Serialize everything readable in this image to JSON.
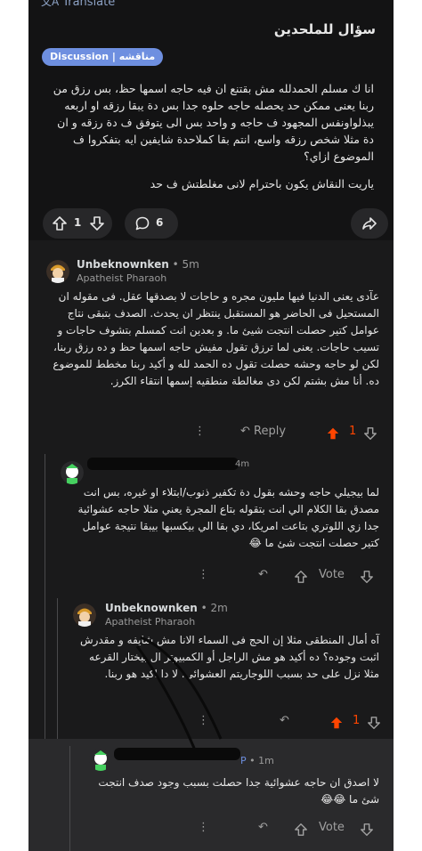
{
  "colors": {
    "background": "#1a1a1b",
    "header_bg": "#131314",
    "flair_bg": "#6e8fe0",
    "upvote_active": "#ff4500",
    "link": "#8da2c5"
  },
  "header": {
    "translate_label": "Translate",
    "translate_icon": "translate-icon"
  },
  "post": {
    "title": "سؤال للملحدين",
    "flair": "Discussion | مناقشه",
    "body_paragraphs": [
      "انا ك مسلم الحمدلله مش بقتنع ان فيه حاجه اسمها حظ، بس رزق من ربنا يعنى ممكن حد يحصله حاجه حلوه جدا بس دة يبقا رزقه او اربعه يبذلواونفس المجهود ف حاجه و واحد بس الى يتوفق ف دة رزقه و ان دة مثلا شخص رزقه واسع، انتم بقا كملاحدة شايفين ايه بتفكروا ف الموضوع ازاي؟",
      "ياريت النقاش يكون باحترام لانى مغلطتش ف حد"
    ],
    "votes": "1",
    "comments": "6",
    "share_icon": "share-icon"
  },
  "comments": [
    {
      "username": "Unbeknownken",
      "time": "5m",
      "user_flair": "Apatheist Pharaoh",
      "text": "عآدى يعنى الدنيا فيها مليون مجره و حاجات لا بصدقها عقل. فى مقوله ان المستحيل فى الحاضر هو المستقبل ينتظر ان يحدث. الصدف بتبقى نتاج عوامل كتير حصلت انتجت شيئ ما. و بعدين انت كمسلم بتشوف حاجات و تسيب حاجات. يعنى لما ترزق تقول مفيش حاجه اسمها حظ و ده رزق ربنا، لكن لو حاجه وحشه حصلت تقول ده الحمد لله و أكيد ربنا مخطط للموضوع ده. أنا مش بشتم لكن دى مغالطة منطقيه إسمها انتقاء الكرز.",
      "reply_label": "Reply",
      "votes": "1"
    },
    {
      "time": "4m",
      "text": "لما بيجيلي حاجه وحشه بقول دة تكفير ذنوب/ابتلاء او غيره، بس انت مصدق بقا الكلام الي انت بتقوله بتاع المجرة يعني مثلا حاجه عشوائية جدا زي اللوتري بتاعت امريكا، دي بقا الي بيكسبها بيبقا نتيجة عوامل كتير حصلت انتجت شئ ما 😂",
      "vote_label": "Vote"
    },
    {
      "username": "Unbeknownken",
      "time": "2m",
      "user_flair": "Apatheist Pharaoh",
      "text": "آه أمال المنطقى مثلا إن الحج فى السماء الانا مش شايفه و مقدرش اثبت وجوده؟ ده أكيد هو مش الراجل أو الكمبيوتر ال بيختار القرعه مثلا نزل على حد بسبب اللوجاريتم العشوائي. لا دا اكيد هو ربنا.",
      "votes": "1"
    },
    {
      "time": "1m",
      "text": "لا اصدق ان حاجه عشوائية جدا حصلت بسبب وجود صدف انتجت شئ ما 😂😂",
      "vote_label": "Vote"
    }
  ]
}
